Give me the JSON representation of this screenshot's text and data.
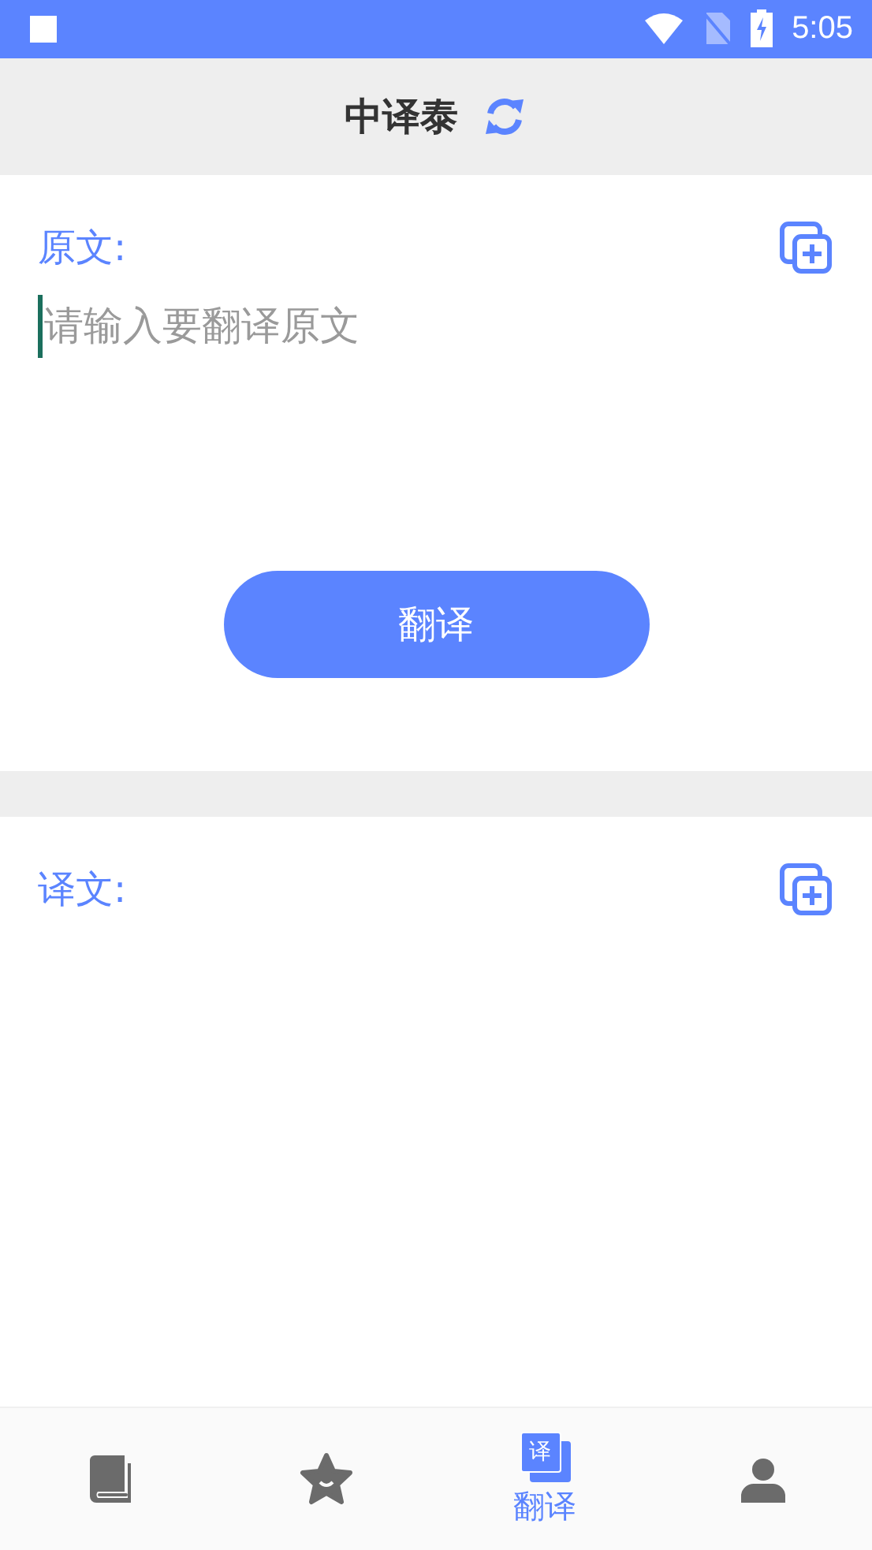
{
  "status_bar": {
    "time": "5:05"
  },
  "header": {
    "title": "中译泰"
  },
  "source": {
    "label": "原文:",
    "placeholder": "请输入要翻译原文"
  },
  "translate_button": {
    "label": "翻译"
  },
  "result": {
    "label": "译文:"
  },
  "bottom_nav": [
    {
      "kind": "book",
      "selected": false
    },
    {
      "kind": "star",
      "selected": false
    },
    {
      "kind": "translate",
      "selected": true,
      "icon_text": "译",
      "label": "翻译"
    },
    {
      "kind": "person",
      "selected": false
    }
  ]
}
